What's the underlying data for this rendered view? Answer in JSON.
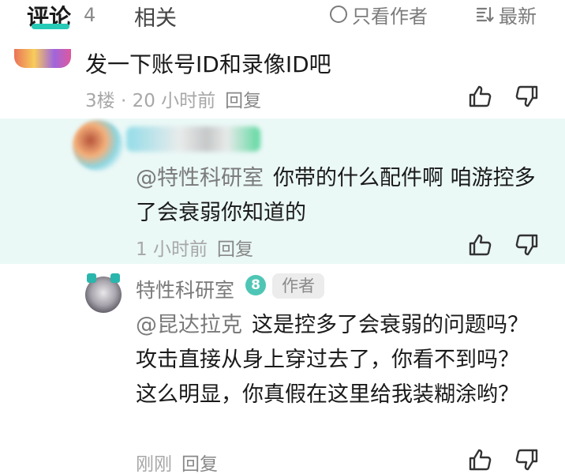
{
  "tabs": {
    "comments_label": "评论",
    "comments_count": "4",
    "related_label": "相关",
    "only_author_label": "只看作者",
    "sort_label": "最新",
    "accent_color": "#27c9b7"
  },
  "comment": {
    "text": "发一下账号ID和录像ID吧",
    "floor_time": "3楼 · 20 小时前",
    "reply_label": "回复"
  },
  "highlighted_reply": {
    "mention": "@特性科研室",
    "text": "你带的什么配件啊 咱游控多了会衰弱你知道的",
    "time": "1 小时前",
    "reply_label": "回复",
    "background": "#eaf8f6"
  },
  "author_reply": {
    "name": "特性科研室",
    "level": "8",
    "tag": "作者",
    "mention": "@昆达拉克",
    "text": "这是控多了会衰弱的问题吗？攻击直接从身上穿过去了，你看不到吗？这么明显，你真假在这里给我装糊涂哟？",
    "time": "刚刚",
    "reply_label": "回复"
  },
  "icons": {
    "like": "thumbs-up-icon",
    "dislike": "thumbs-down-icon",
    "radio": "radio-circle-icon",
    "sort": "sort-lines-icon"
  }
}
